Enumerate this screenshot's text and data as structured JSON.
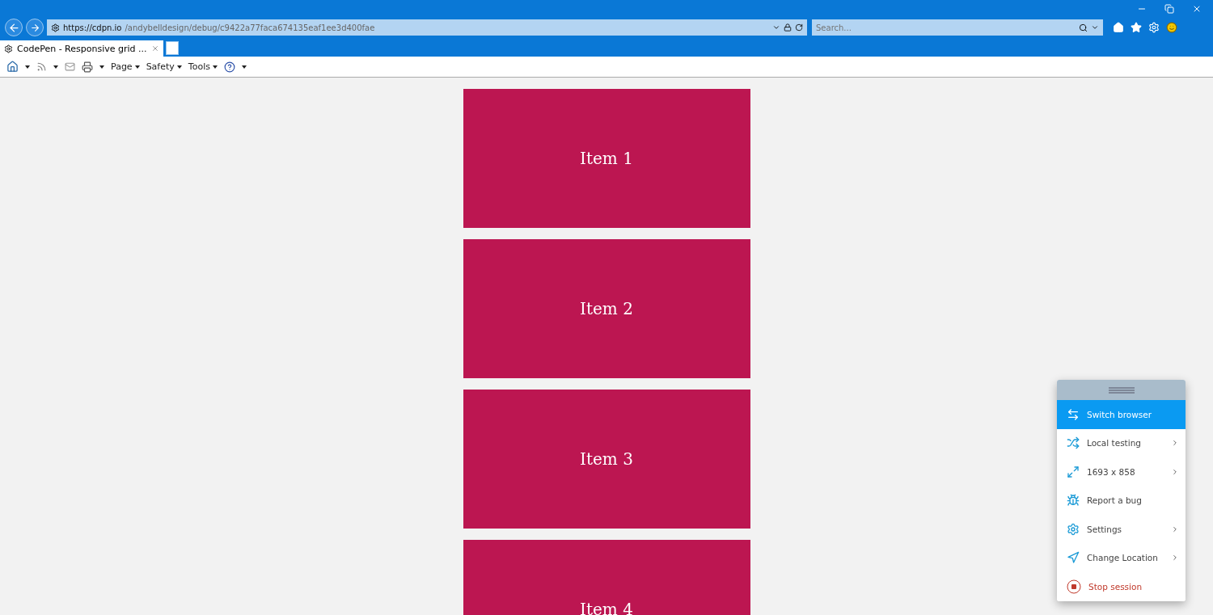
{
  "address_bar": {
    "host": "https://cdpn.io",
    "path": "/andybelldesign/debug/c9422a77faca674135eaf1ee3d400fae"
  },
  "search": {
    "placeholder": "Search..."
  },
  "tabs": [
    {
      "label": "CodePen - Responsive grid ...",
      "selected": true
    }
  ],
  "command_bar": [
    "Page",
    "Safety",
    "Tools"
  ],
  "grid_items": [
    "Item 1",
    "Item 2",
    "Item 3",
    "Item 4"
  ],
  "session_menu": [
    {
      "kind": "switch",
      "label": "Switch browser",
      "selected": true,
      "submenu": false
    },
    {
      "kind": "local",
      "label": "Local testing",
      "selected": false,
      "submenu": true
    },
    {
      "kind": "resize",
      "label": "1693 x 858",
      "selected": false,
      "submenu": true
    },
    {
      "kind": "bug",
      "label": "Report a bug",
      "selected": false,
      "submenu": false
    },
    {
      "kind": "settings",
      "label": "Settings",
      "selected": false,
      "submenu": true
    },
    {
      "kind": "location",
      "label": "Change Location",
      "selected": false,
      "submenu": true
    },
    {
      "kind": "stop",
      "label": "Stop session",
      "selected": false,
      "submenu": false
    }
  ]
}
